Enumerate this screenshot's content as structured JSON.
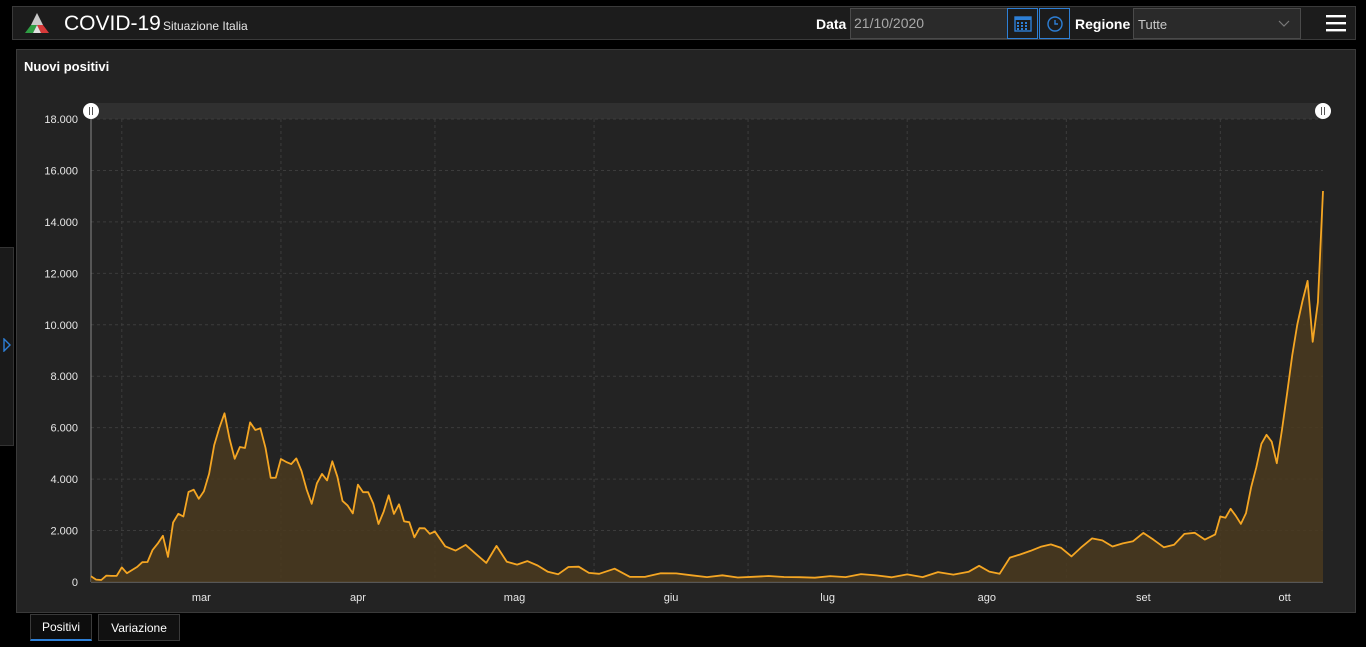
{
  "header": {
    "title": "COVID-19",
    "subtitle": "Situazione Italia",
    "date_label": "Data",
    "date_value": "21/10/2020",
    "region_label": "Regione",
    "region_value": "Tutte"
  },
  "panel": {
    "title": "Nuovi positivi"
  },
  "tabs": [
    {
      "label": "Positivi",
      "active": true
    },
    {
      "label": "Variazione",
      "active": false
    }
  ],
  "colors": {
    "line": "#f5a623",
    "fill": "#4a3a1e",
    "accent": "#2d7fd6",
    "grid": "#3c3c3c"
  },
  "chart_data": {
    "type": "area",
    "title": "Nuovi positivi",
    "ylim": [
      0,
      18000
    ],
    "yticks": [
      "18.000",
      "16.000",
      "14.000",
      "12.000",
      "10.000",
      "8.000",
      "6.000",
      "4.000",
      "2.000",
      "0"
    ],
    "ytick_values": [
      18000,
      16000,
      14000,
      12000,
      10000,
      8000,
      6000,
      4000,
      2000,
      0
    ],
    "x_start": "2020-02-24",
    "x_end": "2020-10-21",
    "month_labels": [
      "mar",
      "apr",
      "mag",
      "giu",
      "lug",
      "ago",
      "set",
      "ott"
    ],
    "month_starts": [
      "2020-03-01",
      "2020-04-01",
      "2020-05-01",
      "2020-06-01",
      "2020-07-01",
      "2020-08-01",
      "2020-09-01",
      "2020-10-01"
    ],
    "grid": true,
    "series": [
      {
        "dates": [
          "2020-02-24",
          "2020-02-25",
          "2020-02-26",
          "2020-02-27",
          "2020-02-28",
          "2020-02-29",
          "2020-03-01",
          "2020-03-02",
          "2020-03-03",
          "2020-03-04",
          "2020-03-05",
          "2020-03-06",
          "2020-03-07",
          "2020-03-08",
          "2020-03-09",
          "2020-03-10",
          "2020-03-11",
          "2020-03-12",
          "2020-03-13",
          "2020-03-14",
          "2020-03-15",
          "2020-03-16",
          "2020-03-17",
          "2020-03-18",
          "2020-03-19",
          "2020-03-20",
          "2020-03-21",
          "2020-03-22",
          "2020-03-23",
          "2020-03-24",
          "2020-03-25",
          "2020-03-26",
          "2020-03-27",
          "2020-03-28",
          "2020-03-29",
          "2020-03-30",
          "2020-03-31",
          "2020-04-01",
          "2020-04-02",
          "2020-04-03",
          "2020-04-04",
          "2020-04-05",
          "2020-04-06",
          "2020-04-07",
          "2020-04-08",
          "2020-04-09",
          "2020-04-10",
          "2020-04-11",
          "2020-04-12",
          "2020-04-13",
          "2020-04-14",
          "2020-04-15",
          "2020-04-16",
          "2020-04-17",
          "2020-04-18",
          "2020-04-19",
          "2020-04-20",
          "2020-04-21",
          "2020-04-22",
          "2020-04-23",
          "2020-04-24",
          "2020-04-25",
          "2020-04-26",
          "2020-04-27",
          "2020-04-28",
          "2020-04-29",
          "2020-04-30",
          "2020-05-01",
          "2020-05-03",
          "2020-05-05",
          "2020-05-07",
          "2020-05-09",
          "2020-05-11",
          "2020-05-13",
          "2020-05-15",
          "2020-05-17",
          "2020-05-19",
          "2020-05-21",
          "2020-05-23",
          "2020-05-25",
          "2020-05-27",
          "2020-05-29",
          "2020-05-31",
          "2020-06-02",
          "2020-06-05",
          "2020-06-08",
          "2020-06-11",
          "2020-06-14",
          "2020-06-17",
          "2020-06-20",
          "2020-06-23",
          "2020-06-26",
          "2020-06-29",
          "2020-07-02",
          "2020-07-05",
          "2020-07-08",
          "2020-07-11",
          "2020-07-14",
          "2020-07-17",
          "2020-07-20",
          "2020-07-23",
          "2020-07-26",
          "2020-07-29",
          "2020-08-01",
          "2020-08-04",
          "2020-08-07",
          "2020-08-10",
          "2020-08-13",
          "2020-08-15",
          "2020-08-17",
          "2020-08-19",
          "2020-08-21",
          "2020-08-23",
          "2020-08-25",
          "2020-08-27",
          "2020-08-29",
          "2020-08-31",
          "2020-09-02",
          "2020-09-04",
          "2020-09-06",
          "2020-09-08",
          "2020-09-10",
          "2020-09-12",
          "2020-09-14",
          "2020-09-16",
          "2020-09-18",
          "2020-09-20",
          "2020-09-22",
          "2020-09-24",
          "2020-09-26",
          "2020-09-28",
          "2020-09-30",
          "2020-10-01",
          "2020-10-02",
          "2020-10-03",
          "2020-10-04",
          "2020-10-05",
          "2020-10-06",
          "2020-10-07",
          "2020-10-08",
          "2020-10-09",
          "2020-10-10",
          "2020-10-11",
          "2020-10-12",
          "2020-10-13",
          "2020-10-14",
          "2020-10-15",
          "2020-10-16",
          "2020-10-17",
          "2020-10-18",
          "2020-10-19",
          "2020-10-20",
          "2020-10-21"
        ],
        "values": [
          221,
          93,
          78,
          250,
          238,
          240,
          566,
          342,
          466,
          587,
          769,
          778,
          1247,
          1492,
          1797,
          977,
          2313,
          2651,
          2547,
          3497,
          3590,
          3233,
          3526,
          4207,
          5322,
          5986,
          6557,
          5560,
          4789,
          5249,
          5210,
          6203,
          5909,
          5974,
          5217,
          4050,
          4053,
          4782,
          4668,
          4585,
          4805,
          4316,
          3599,
          3039,
          3836,
          4204,
          3951,
          4694,
          4092,
          3153,
          2972,
          2667,
          3786,
          3493,
          3491,
          3047,
          2256,
          2729,
          3370,
          2646,
          3021,
          2357,
          2324,
          1739,
          2091,
          2086,
          1872,
          1965,
          1389,
          1221,
          1444,
          1083,
          744,
          1402,
          789,
          675,
          813,
          642,
          397,
          300,
          584,
          593,
          355,
          318,
          518,
          197,
          202,
          338,
          333,
          262,
          190,
          259,
          174,
          201,
          235,
          193,
          188,
          169,
          230,
          190,
          306,
          255,
          181,
          295,
          190,
          384,
          289,
          401,
          629,
          403,
          320,
          947,
          1071,
          1210,
          1367,
          1462,
          1326,
          996,
          1365,
          1695,
          1616,
          1380,
          1501,
          1587,
          1907,
          1640,
          1350,
          1452,
          1869,
          1912,
          1648,
          1851,
          2548,
          2499,
          2844,
          2578,
          2257,
          2677,
          3678,
          4458,
          5372,
          5724,
          5456,
          4619,
          5901,
          7332,
          8804,
          10010,
          10925,
          11705,
          9338,
          10874,
          15199
        ]
      }
    ]
  }
}
